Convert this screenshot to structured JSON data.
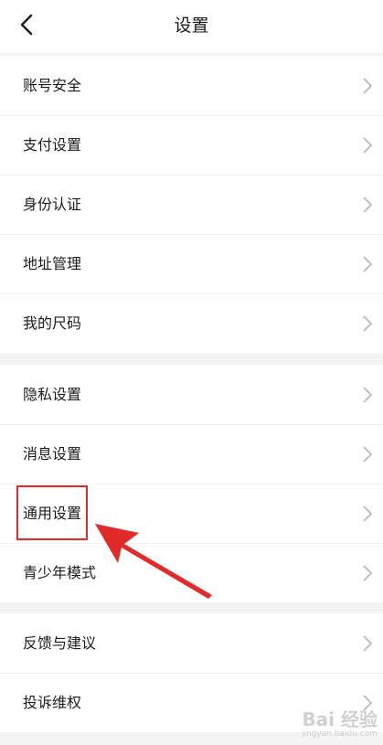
{
  "header": {
    "title": "设置"
  },
  "groups": [
    {
      "items": [
        {
          "label": "账号安全"
        },
        {
          "label": "支付设置"
        },
        {
          "label": "身份认证"
        },
        {
          "label": "地址管理"
        },
        {
          "label": "我的尺码"
        }
      ]
    },
    {
      "items": [
        {
          "label": "隐私设置"
        },
        {
          "label": "消息设置"
        },
        {
          "label": "通用设置"
        },
        {
          "label": "青少年模式"
        }
      ]
    },
    {
      "items": [
        {
          "label": "反馈与建议"
        },
        {
          "label": "投诉维权"
        }
      ]
    }
  ],
  "annotation": {
    "color": "#e12a2a"
  },
  "watermark": {
    "main": "Bai 经验",
    "sub": "jingyan.baidu.com"
  }
}
